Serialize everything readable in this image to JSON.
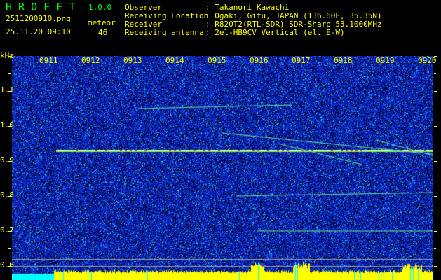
{
  "app": {
    "title": "H R O F F T",
    "version": "1.0.0"
  },
  "file": {
    "name": "2511200910.png",
    "datetime": "25.11.20 09:10"
  },
  "meteor": {
    "label": "meteor",
    "count": "46"
  },
  "info": [
    {
      "key": "Observer",
      "value": ": Takanori Kawachi"
    },
    {
      "key": "Receiving Location",
      "value": ": Ogaki, Gifu, JAPAN (136.60E, 35.35N)"
    },
    {
      "key": "Receiver",
      "value": ": R820T2(RTL-SDR) SDR-Sharp 53.1000MHz"
    },
    {
      "key": "Receiving antenna",
      "value": ": 2el-HB9CV Vertical (el. E-W)"
    }
  ],
  "spectrogram": {
    "y_unit": "kHz",
    "y_ticks": [
      "1.1",
      "1.0",
      "0.9",
      "0.8",
      "0.7",
      "0.6"
    ],
    "x_ticks": [
      "0911",
      "0912",
      "0913",
      "0914",
      "0915",
      "0916",
      "0917",
      "0918",
      "0919",
      "0920"
    ],
    "colors": {
      "background": "#000000",
      "noise": "#1a2fd0",
      "signal": "#ffff00",
      "text": "#ffff00",
      "title": "#00ff00"
    }
  }
}
